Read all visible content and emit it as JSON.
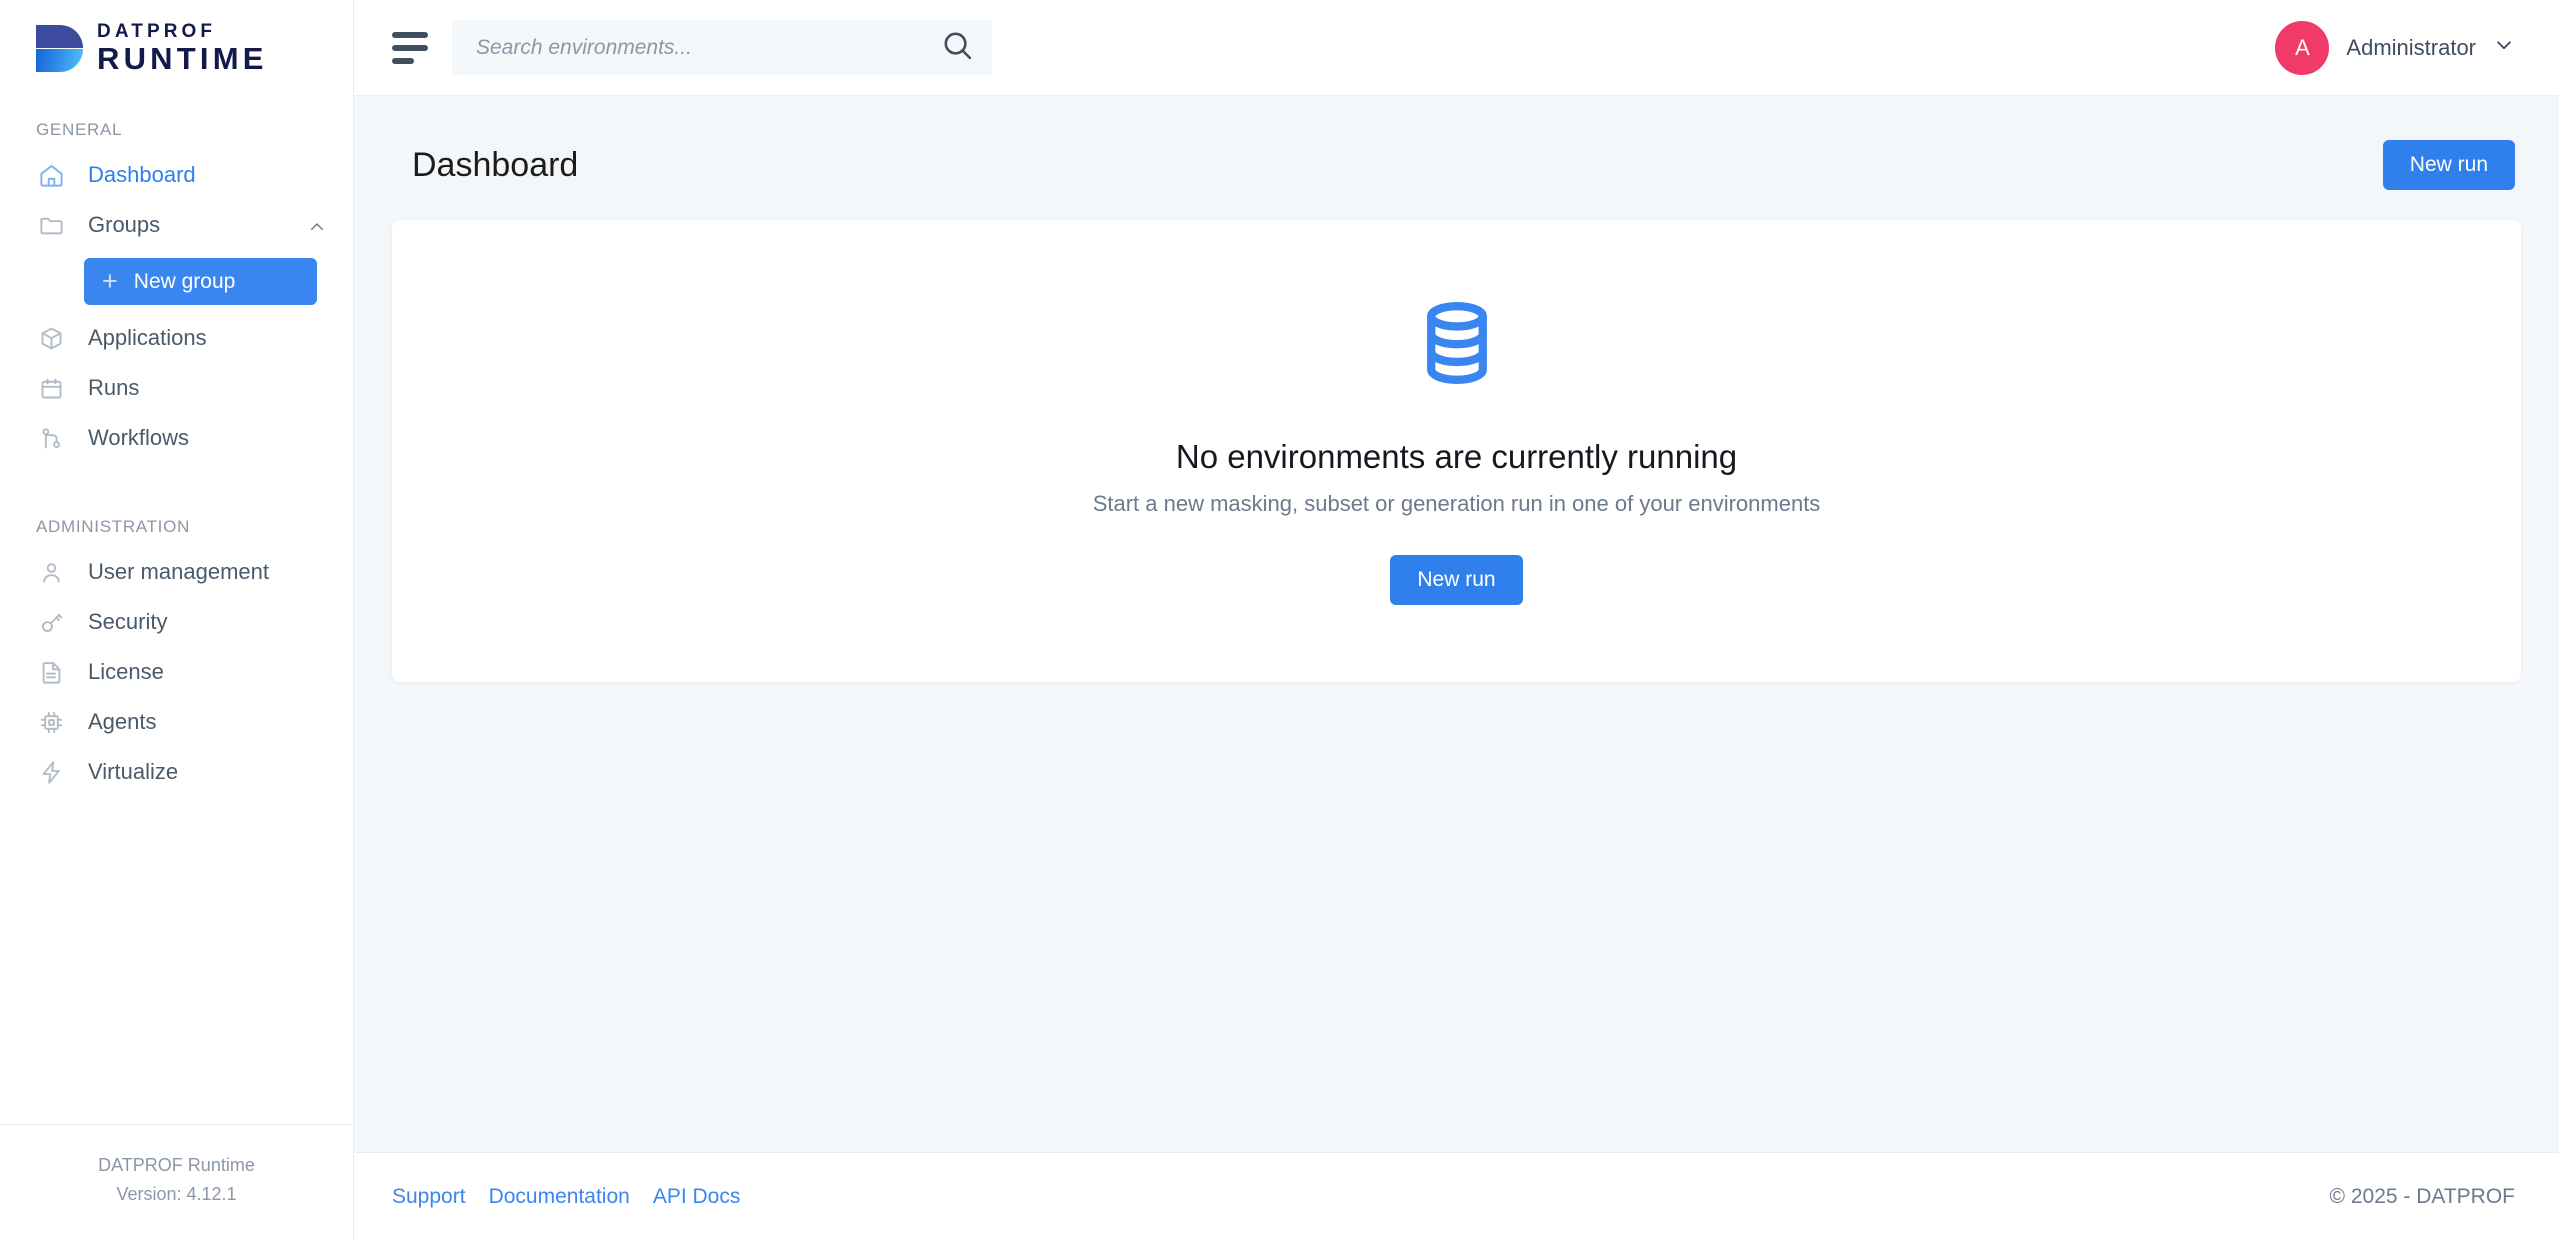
{
  "brand": {
    "logo_top_line": "DATPROF",
    "logo_bottom_line": "RUNTIME"
  },
  "topbar": {
    "menu_icon": "hamburger-icon",
    "search": {
      "placeholder": "Search environments...",
      "value": "",
      "icon": "search-icon"
    },
    "user": {
      "avatar_initial": "A",
      "name": "Administrator",
      "chevron": "chevron-down-icon",
      "avatar_color": "#f03a68"
    }
  },
  "sidebar": {
    "sections": [
      {
        "title": "GENERAL",
        "items": [
          {
            "label": "Dashboard",
            "icon": "home-icon",
            "active": true
          },
          {
            "label": "Groups",
            "icon": "folder-icon",
            "active": false,
            "expanded": true,
            "chevron": "chevron-up-icon"
          },
          {
            "label": "Applications",
            "icon": "package-icon",
            "active": false
          },
          {
            "label": "Runs",
            "icon": "calendar-icon",
            "active": false
          },
          {
            "label": "Workflows",
            "icon": "git-branch-icon",
            "active": false
          }
        ]
      },
      {
        "title": "ADMINISTRATION",
        "items": [
          {
            "label": "User management",
            "icon": "user-icon",
            "active": false
          },
          {
            "label": "Security",
            "icon": "key-icon",
            "active": false
          },
          {
            "label": "License",
            "icon": "document-icon",
            "active": false
          },
          {
            "label": "Agents",
            "icon": "cpu-chip-icon",
            "active": false
          },
          {
            "label": "Virtualize",
            "icon": "lightning-bolt-icon",
            "active": false
          }
        ]
      }
    ],
    "new_group_button": {
      "label": "New group",
      "icon": "plus-icon"
    },
    "footer": {
      "product": "DATPROF Runtime",
      "version": "Version: 4.12.1"
    }
  },
  "main": {
    "page_title": "Dashboard",
    "new_run_button_top": "New run",
    "empty_state": {
      "icon": "database-icon",
      "title": "No environments are currently running",
      "subtitle": "Start a new masking, subset or generation run in one of your environments",
      "button_label": "New run"
    }
  },
  "footer": {
    "links": [
      {
        "label": "Support"
      },
      {
        "label": "Documentation"
      },
      {
        "label": "API Docs"
      }
    ],
    "copyright": "© 2025 - DATPROF"
  },
  "colors": {
    "accent_blue": "#2f80ed",
    "button_blue": "#3a86f0",
    "avatar_pink": "#f03a68",
    "logo_indigo": "#3c4b9e",
    "page_bg": "#f4f7fa"
  }
}
